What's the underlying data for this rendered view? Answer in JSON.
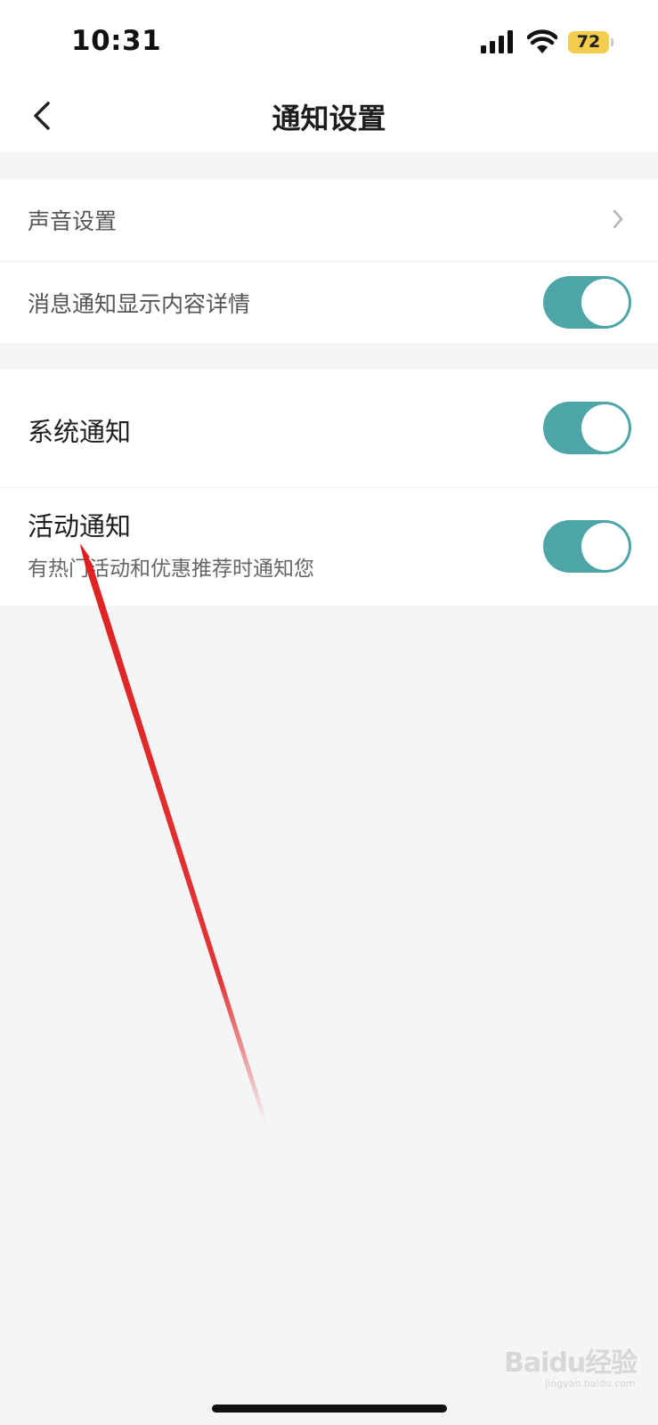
{
  "status_bar": {
    "time": "10:31",
    "battery": "72",
    "signal_icon": "cellular-signal-icon",
    "wifi_icon": "wifi-icon",
    "battery_color": "#f5cc4d"
  },
  "header": {
    "title": "通知设置",
    "back_icon": "chevron-left-icon"
  },
  "section1": {
    "sound_settings_label": "声音设置",
    "show_detail_label": "消息通知显示内容详情",
    "show_detail_enabled": true
  },
  "section2": {
    "system_notice_label": "系统通知",
    "system_notice_enabled": true,
    "activity_notice_label": "活动通知",
    "activity_notice_desc": "有热门活动和优惠推荐时通知您",
    "activity_notice_enabled": true
  },
  "colors": {
    "toggle_on": "#4ea5a8",
    "annotation_arrow": "#e02020"
  },
  "watermark": {
    "text": "Baidu经验",
    "sub": "jingyan.baidu.com"
  }
}
